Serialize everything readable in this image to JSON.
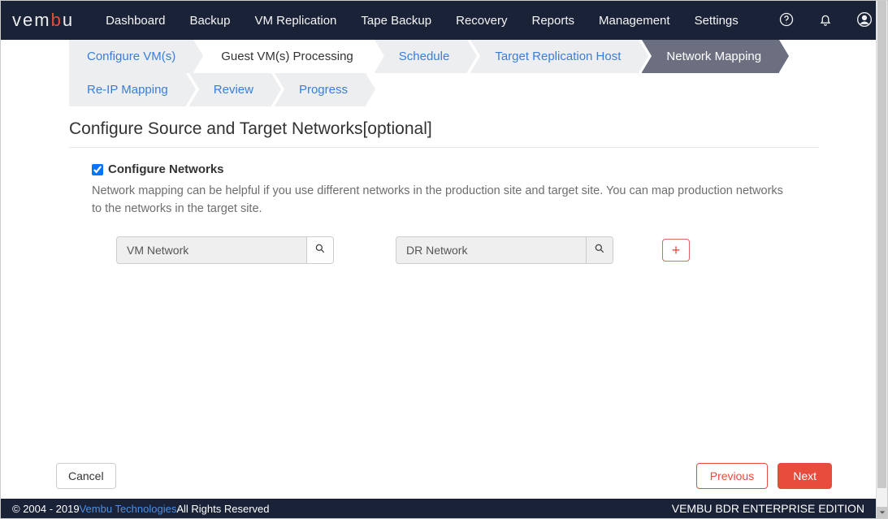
{
  "logo": {
    "pre": "vem",
    "accentLetter": "b",
    "post": "u"
  },
  "nav": {
    "items": [
      "Dashboard",
      "Backup",
      "VM Replication",
      "Tape Backup",
      "Recovery",
      "Reports",
      "Management",
      "Settings"
    ]
  },
  "wizard": {
    "row1": [
      {
        "label": "Configure VM(s)",
        "state": "link"
      },
      {
        "label": "Guest VM(s) Processing",
        "state": "plain"
      },
      {
        "label": "Schedule",
        "state": "link"
      },
      {
        "label": "Target Replication Host",
        "state": "link"
      },
      {
        "label": "Network Mapping",
        "state": "active"
      }
    ],
    "row2": [
      {
        "label": "Re-IP Mapping",
        "state": "link"
      },
      {
        "label": "Review",
        "state": "link"
      },
      {
        "label": "Progress",
        "state": "link"
      }
    ]
  },
  "pageTitle": "Configure Source and Target Networks[optional]",
  "configNetworks": {
    "checked": true,
    "label": "Configure Networks",
    "desc": "Network mapping can be helpful if you use different networks in the production site and target site. You can map production networks to the networks in the target site."
  },
  "networks": {
    "source": {
      "value": "VM Network"
    },
    "target": {
      "value": "DR Network"
    },
    "addLabel": "+"
  },
  "actions": {
    "cancel": "Cancel",
    "previous": "Previous",
    "next": "Next"
  },
  "footer": {
    "copyrightPre": "© 2004 - 2019 ",
    "company": "Vembu Technologies",
    "copyrightPost": " All Rights Reserved",
    "edition": "VEMBU BDR ENTERPRISE EDITION"
  }
}
